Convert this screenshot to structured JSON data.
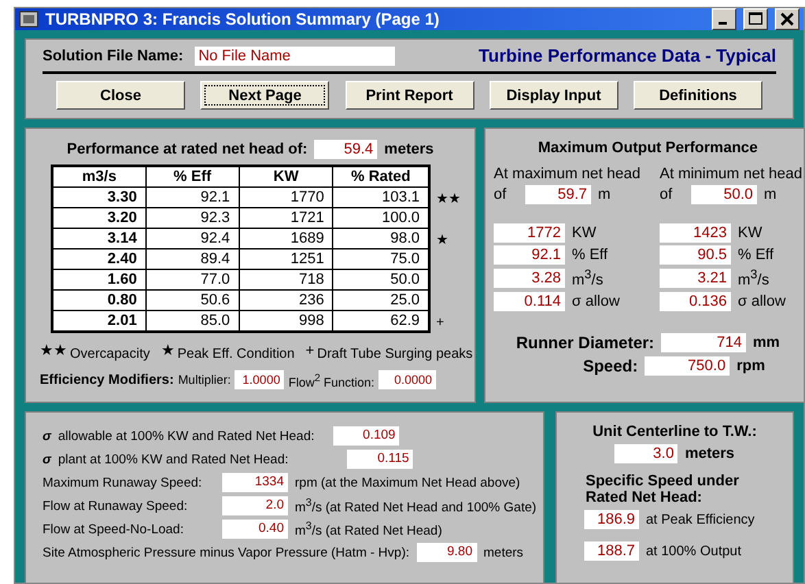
{
  "window": {
    "title": "TURBNPRO 3: Francis Solution Summary (Page 1)"
  },
  "header": {
    "file_label": "Solution File Name:",
    "file_value": "No File Name",
    "heading": "Turbine Performance Data - Typical"
  },
  "buttons": [
    {
      "label": "Close",
      "focused": false
    },
    {
      "label": "Next Page",
      "focused": true
    },
    {
      "label": "Print Report",
      "focused": false
    },
    {
      "label": "Display Input",
      "focused": false
    },
    {
      "label": "Definitions",
      "focused": false
    }
  ],
  "performance": {
    "title": "Performance at rated net head of:",
    "head_value": "59.4",
    "head_unit": "meters",
    "columns": [
      "m3/s",
      "% Eff",
      "KW",
      "% Rated"
    ],
    "rows": [
      {
        "cells": [
          "3.30",
          "92.1",
          "1770",
          "103.1"
        ],
        "marker": "★★"
      },
      {
        "cells": [
          "3.20",
          "92.3",
          "1721",
          "100.0"
        ]
      },
      {
        "cells": [
          "3.14",
          "92.4",
          "1689",
          "98.0"
        ],
        "marker": "★"
      },
      {
        "cells": [
          "2.40",
          "89.4",
          "1251",
          "75.0"
        ]
      },
      {
        "cells": [
          "1.60",
          "77.0",
          "718",
          "50.0"
        ]
      },
      {
        "cells": [
          "0.80",
          "50.6",
          "236",
          "25.0"
        ]
      },
      {
        "cells": [
          "2.01",
          "85.0",
          "998",
          "62.9"
        ],
        "marker": "+"
      }
    ],
    "legend": [
      {
        "mark": "★★",
        "label": "Overcapacity"
      },
      {
        "mark": "★",
        "label": "Peak Eff. Condition"
      },
      {
        "mark": "+",
        "label": "Draft Tube Surging peaks"
      }
    ],
    "modifiers": {
      "label": "Efficiency Modifiers:",
      "multiplier_label": "Multiplier:",
      "multiplier": "1.0000",
      "flow_label": "Flow$^{2}$ Function:",
      "flow": "0.0000"
    }
  },
  "max_output": {
    "title": "Maximum Output Performance",
    "columns": [
      {
        "heading": "At maximum net head",
        "of": "of",
        "head": "59.7",
        "head_unit": "m",
        "values": [
          {
            "value": "1772",
            "unit": "KW"
          },
          {
            "value": "92.1",
            "unit": "% Eff"
          },
          {
            "value": "3.28",
            "unit": "m$^{3}$/s"
          },
          {
            "value": "0.114",
            "unit": "σ allow"
          }
        ]
      },
      {
        "heading": "At minimum net head",
        "of": "of",
        "head": "50.0",
        "head_unit": "m",
        "values": [
          {
            "value": "1423",
            "unit": "KW"
          },
          {
            "value": "90.5",
            "unit": "% Eff"
          },
          {
            "value": "3.21",
            "unit": "m$^{3}$/s"
          },
          {
            "value": "0.136",
            "unit": "σ allow"
          }
        ]
      }
    ],
    "runner_label": "Runner Diameter:",
    "runner_value": "714",
    "runner_unit": "mm",
    "speed_label": "Speed:",
    "speed_value": "750.0",
    "speed_unit": "rpm"
  },
  "site": [
    {
      "sigma": "σ",
      "label": "allowable at 100% KW and Rated Net Head:",
      "value": "0.109"
    },
    {
      "sigma": "σ",
      "label": "plant at 100% KW and Rated Net Head:",
      "value": "0.115"
    },
    {
      "label": "Maximum Runaway Speed:",
      "value": "1334",
      "note": "rpm (at the Maximum Net Head above)"
    },
    {
      "label": "Flow at Runaway Speed:",
      "value": "2.0",
      "note": "m$^{3}$/s (at Rated Net Head and 100% Gate)"
    },
    {
      "label": "Flow at Speed-No-Load:",
      "value": "0.40",
      "note": "m$^{3}$/s (at Rated Net Head)"
    },
    {
      "label": "Site Atmospheric Pressure minus Vapor Pressure (Hatm - Hvp):",
      "value": "9.80",
      "note": "meters"
    }
  ],
  "centerline": {
    "title": "Unit Centerline to T.W.:",
    "value": "3.0",
    "unit": "meters",
    "specific_title": "Specific Speed under Rated Net Head:",
    "specific": [
      {
        "value": "186.9",
        "label": "at Peak Efficiency"
      },
      {
        "value": "188.7",
        "label": "at 100% Output"
      }
    ]
  }
}
